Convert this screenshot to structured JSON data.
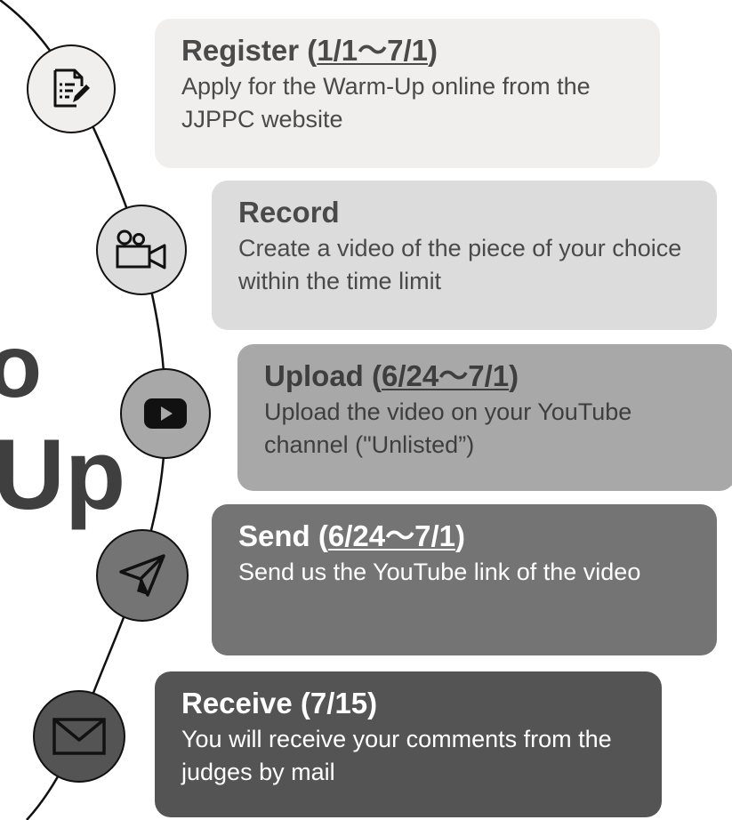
{
  "background_text": {
    "letter_1": "o",
    "letter_2": "Up"
  },
  "steps": [
    {
      "title": "Register",
      "date_open": " (",
      "date": "1/1～7/1",
      "date_close": ")",
      "description": "Apply for the Warm-Up online from the JJPPC website",
      "icon": "document-edit-icon",
      "card_color": "#f1efee",
      "text_color": "#4a4a4a",
      "circle_color": "#f1efee"
    },
    {
      "title": "Record",
      "date_open": "",
      "date": "",
      "date_close": "",
      "description": "Create a video of the piece of your choice within the time limit",
      "icon": "video-camera-icon",
      "card_color": "#dcdcdc",
      "text_color": "#4a4a4a",
      "circle_color": "#dcdcdc"
    },
    {
      "title": "Upload",
      "date_open": " (",
      "date": "6/24～7/1",
      "date_close": ")",
      "description": "Upload the video on your YouTube channel (\"Unlisted”)",
      "icon": "youtube-play-icon",
      "card_color": "#a8a8a8",
      "text_color": "#3e3e3e",
      "circle_color": "#a8a8a8"
    },
    {
      "title": "Send",
      "date_open": " (",
      "date": "6/24～7/1",
      "date_close": ")",
      "description": "Send us the YouTube link of the video",
      "icon": "paper-plane-icon",
      "card_color": "#747474",
      "text_color": "#ffffff",
      "circle_color": "#747474"
    },
    {
      "title": "Receive (7/15)",
      "date_open": "",
      "date": "",
      "date_close": "",
      "description": "You will receive your comments from the judges by mail",
      "icon": "envelope-icon",
      "card_color": "#545454",
      "text_color": "#ffffff",
      "circle_color": "#545454"
    }
  ]
}
